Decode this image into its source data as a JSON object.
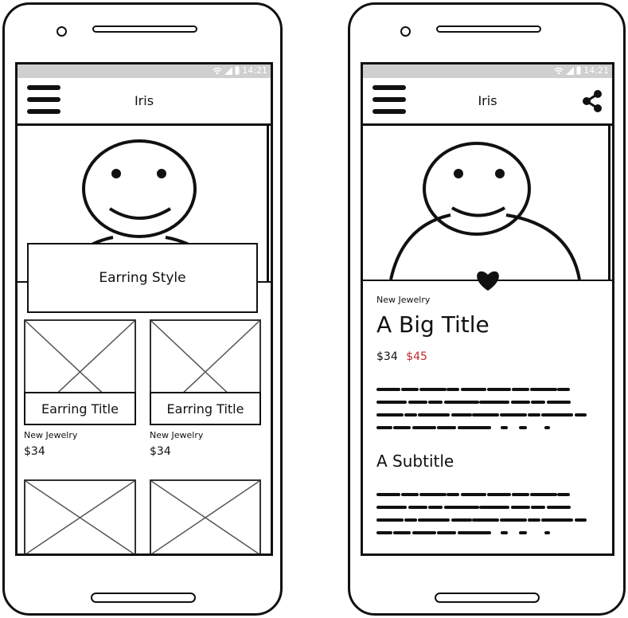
{
  "left_screen": {
    "status_time": "14:21",
    "app_title": "Iris",
    "hero_caption": "Earring Style",
    "cards": [
      {
        "title": "Earring Title",
        "category": "New Jewelry",
        "price": "$34"
      },
      {
        "title": "Earring Title",
        "category": "New Jewelry",
        "price": "$34"
      }
    ]
  },
  "right_screen": {
    "status_time": "14:21",
    "app_title": "Iris",
    "category": "New Jewelry",
    "title": "A Big Title",
    "price": "$34",
    "old_price": "$45",
    "subtitle": "A Subtitle"
  },
  "colors": {
    "ink": "#111111",
    "statusbar": "#cfcfcf",
    "sale_red": "#c0282d"
  },
  "icons": [
    "menu-icon",
    "share-icon",
    "heart-icon",
    "wifi-icon",
    "signal-icon",
    "battery-icon"
  ]
}
